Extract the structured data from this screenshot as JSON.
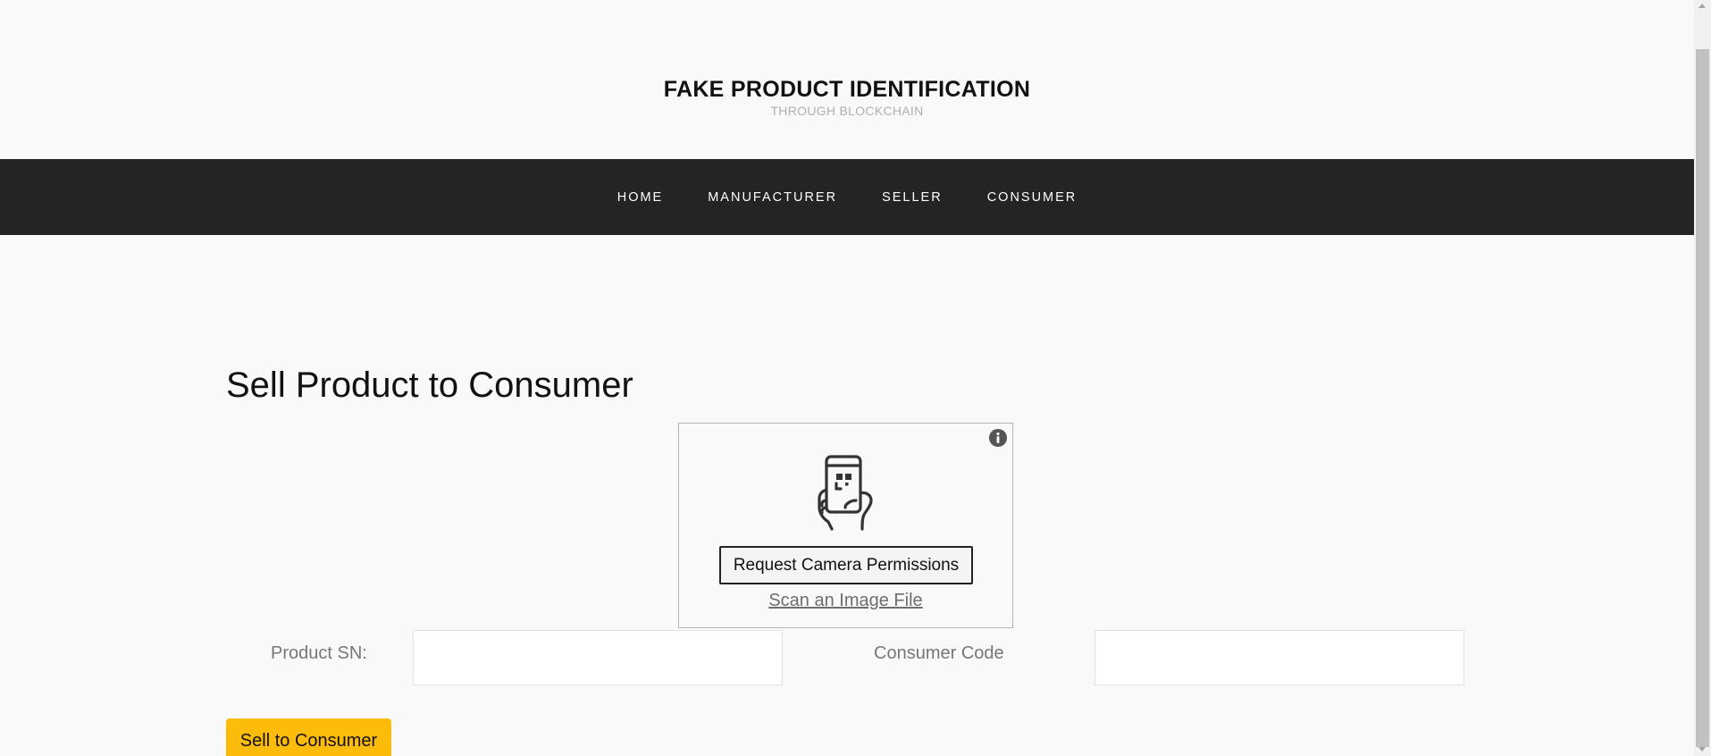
{
  "header": {
    "title": "FAKE PRODUCT IDENTIFICATION",
    "subtitle": "THROUGH BLOCKCHAIN"
  },
  "nav": {
    "items": [
      {
        "label": "HOME"
      },
      {
        "label": "MANUFACTURER"
      },
      {
        "label": "SELLER"
      },
      {
        "label": "CONSUMER"
      }
    ]
  },
  "main": {
    "title": "Sell Product to Consumer",
    "scanner": {
      "camera_button": "Request Camera Permissions",
      "scan_file_link": "Scan an Image File",
      "icons": [
        "info-icon",
        "phone-qr-scan-icon"
      ]
    },
    "form": {
      "product_sn_label": "Product SN:",
      "product_sn_value": "",
      "consumer_code_label": "Consumer Code",
      "consumer_code_value": "",
      "submit_label": "Sell to Consumer"
    }
  },
  "colors": {
    "navbar_bg": "#242424",
    "accent_button": "#fdbb0a",
    "page_bg": "#f9f9f9",
    "subtitle": "#b0b0b0"
  }
}
